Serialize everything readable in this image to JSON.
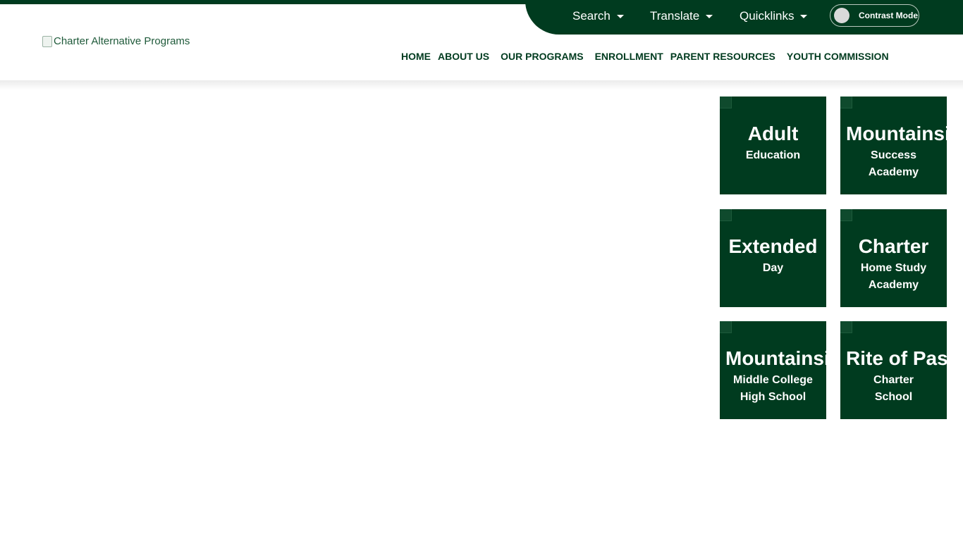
{
  "utility_bar": {
    "search_label": "Search",
    "translate_label": "Translate",
    "quicklinks_label": "Quicklinks",
    "contrast_label": "Contrast Mode",
    "glyph": ""
  },
  "logo": {
    "alt_text": "Charter Alternative Programs"
  },
  "nav": {
    "items": [
      {
        "label": "HOME",
        "dropdown": ""
      },
      {
        "label": "ABOUT US",
        "dropdown": ""
      },
      {
        "label": "OUR PROGRAMS",
        "dropdown": ""
      },
      {
        "label": "ENROLLMENT",
        "dropdown": ""
      },
      {
        "label": "PARENT RESOURCES",
        "dropdown": ""
      },
      {
        "label": "YOUTH COMMISSION",
        "dropdown": ""
      }
    ]
  },
  "carousel": {
    "dot_glyph": ""
  },
  "tiles": [
    {
      "title": "Adult",
      "sub1": "Education",
      "sub2": ""
    },
    {
      "title": "Mountainside",
      "sub1": "Success",
      "sub2": "Academy"
    },
    {
      "title": "Extended",
      "sub1": "Day",
      "sub2": ""
    },
    {
      "title": "Charter",
      "sub1": "Home Study",
      "sub2": "Academy"
    },
    {
      "title": "Mountainside",
      "sub1": "Middle College",
      "sub2": "High School"
    },
    {
      "title": "Rite of Passage",
      "sub1": "Charter",
      "sub2": "School"
    }
  ],
  "colors": {
    "brand_green": "#003b1f",
    "background": "#ffffff"
  }
}
